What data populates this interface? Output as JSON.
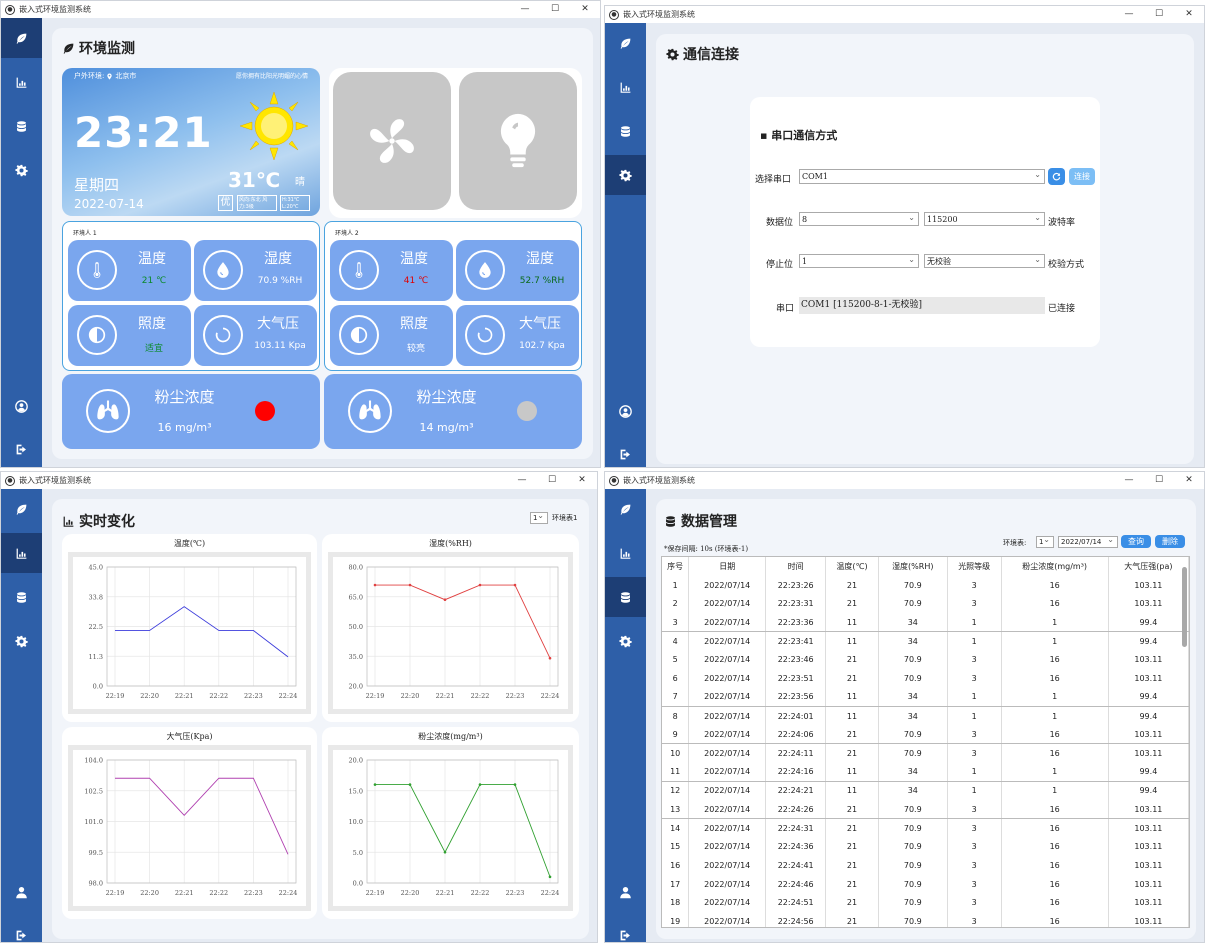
{
  "app_title": "嵌入式环境监测系统",
  "window_controls": {
    "min": "—",
    "max": "☐",
    "close": "✕"
  },
  "colors": {
    "sidebar": "#2e5fa8",
    "sidebar_active": "#1d3e75",
    "card": "#7aa6ee",
    "accent": "#3a8ee6"
  },
  "monitor": {
    "title": "环境监测",
    "weather": {
      "location_label": "户外环境:",
      "city": "北京市",
      "slogan": "愿你拥有比阳光明媚的心情",
      "time": "23:21",
      "weekday": "星期四",
      "date": "2022-07-14",
      "temp": "31℃",
      "condition": "晴",
      "aqi": "优",
      "wind": "风向:东北 风力:3级",
      "range": "H:31℃ L:20℃"
    },
    "env1": {
      "label": "环境人 1",
      "temp_title": "温度",
      "temp_value": "21 ℃",
      "hum_title": "湿度",
      "hum_value": "70.9 %RH",
      "light_title": "照度",
      "light_value": "适宜",
      "press_title": "大气压",
      "press_value": "103.11 Kpa"
    },
    "env2": {
      "label": "环境人 2",
      "temp_title": "温度",
      "temp_value": "41 ℃",
      "hum_title": "湿度",
      "hum_value": "52.7 %RH",
      "light_title": "照度",
      "light_value": "较亮",
      "press_title": "大气压",
      "press_value": "102.7 Kpa"
    },
    "dust1": {
      "title": "粉尘浓度",
      "value": "16 mg/m³",
      "status_color": "#ff0000"
    },
    "dust2": {
      "title": "粉尘浓度",
      "value": "14 mg/m³",
      "status_color": "#c8c8c8"
    }
  },
  "comm": {
    "title": "通信连接",
    "section": "串口通信方式",
    "port_label": "选择串口",
    "port_value": "COM1",
    "connect_label": "连接",
    "databits_label": "数据位",
    "databits_value": "8",
    "baud_value": "115200",
    "baud_label": "波特率",
    "stopbits_label": "停止位",
    "stopbits_value": "1",
    "parity_value": "无校验",
    "parity_label": "校验方式",
    "status_label": "串口",
    "status_value": "COM1 [115200-8-1-无校验]",
    "status_text": "已连接"
  },
  "realtime": {
    "title": "实时变化",
    "env_select": "1",
    "env_label": "环境表1"
  },
  "chart_data": [
    {
      "type": "line",
      "title": "温度(℃)",
      "x": [
        "22:19",
        "22:20",
        "22:21",
        "22:22",
        "22:23",
        "22:24"
      ],
      "series": [
        {
          "values": [
            21,
            21,
            30,
            21,
            21,
            11
          ],
          "color": "#3b3bdb"
        }
      ],
      "ylim": [
        0,
        45
      ],
      "yticks": [
        "45.0",
        "33.8",
        "22.5",
        "11.3",
        "0.0"
      ],
      "markers": false
    },
    {
      "type": "line",
      "title": "湿度(%RH)",
      "x": [
        "22:19",
        "22:20",
        "22:21",
        "22:22",
        "22:23",
        "22:24"
      ],
      "series": [
        {
          "values": [
            70.9,
            70.9,
            63.5,
            70.9,
            70.9,
            34
          ],
          "color": "#e04040"
        }
      ],
      "ylim": [
        20,
        80
      ],
      "yticks": [
        "80.0",
        "65.0",
        "50.0",
        "35.0",
        "20.0"
      ],
      "markers": true
    },
    {
      "type": "line",
      "title": "大气压(Kpa)",
      "x": [
        "22:19",
        "22:20",
        "22:21",
        "22:22",
        "22:23",
        "22:24"
      ],
      "series": [
        {
          "values": [
            103.11,
            103.11,
            101.3,
            103.11,
            103.11,
            99.4
          ],
          "color": "#b040b0"
        }
      ],
      "ylim": [
        98,
        104
      ],
      "yticks": [
        "104.0",
        "102.5",
        "101.0",
        "99.5",
        "98.0"
      ],
      "markers": false
    },
    {
      "type": "line",
      "title": "粉尘浓度(mg/m³)",
      "x": [
        "22:19",
        "22:20",
        "22:21",
        "22:22",
        "22:23",
        "22:24"
      ],
      "series": [
        {
          "values": [
            16,
            16,
            5,
            16,
            16,
            1
          ],
          "color": "#30a030"
        }
      ],
      "ylim": [
        0,
        20
      ],
      "yticks": [
        "20.0",
        "15.0",
        "10.0",
        "5.0",
        "0.0"
      ],
      "markers": true
    }
  ],
  "datamgr": {
    "title": "数据管理",
    "save_note": "*保存间隔: 10s (环境表-1)",
    "env_label": "环境表:",
    "env_value": "1",
    "date_value": "2022/07/14",
    "query_label": "查询",
    "delete_label": "删除",
    "headers": [
      "序号",
      "日期",
      "时间",
      "温度(℃)",
      "湿度(%RH)",
      "光照等级",
      "粉尘浓度(mg/m³)",
      "大气压强(pa)"
    ],
    "rows": [
      [
        "1",
        "2022/07/14",
        "22:23:26",
        "21",
        "70.9",
        "3",
        "16",
        "103.11"
      ],
      [
        "2",
        "2022/07/14",
        "22:23:31",
        "21",
        "70.9",
        "3",
        "16",
        "103.11"
      ],
      [
        "3",
        "2022/07/14",
        "22:23:36",
        "11",
        "34",
        "1",
        "1",
        "99.4"
      ],
      [
        "4",
        "2022/07/14",
        "22:23:41",
        "11",
        "34",
        "1",
        "1",
        "99.4"
      ],
      [
        "5",
        "2022/07/14",
        "22:23:46",
        "21",
        "70.9",
        "3",
        "16",
        "103.11"
      ],
      [
        "6",
        "2022/07/14",
        "22:23:51",
        "21",
        "70.9",
        "3",
        "16",
        "103.11"
      ],
      [
        "7",
        "2022/07/14",
        "22:23:56",
        "11",
        "34",
        "1",
        "1",
        "99.4"
      ],
      [
        "8",
        "2022/07/14",
        "22:24:01",
        "11",
        "34",
        "1",
        "1",
        "99.4"
      ],
      [
        "9",
        "2022/07/14",
        "22:24:06",
        "21",
        "70.9",
        "3",
        "16",
        "103.11"
      ],
      [
        "10",
        "2022/07/14",
        "22:24:11",
        "21",
        "70.9",
        "3",
        "16",
        "103.11"
      ],
      [
        "11",
        "2022/07/14",
        "22:24:16",
        "11",
        "34",
        "1",
        "1",
        "99.4"
      ],
      [
        "12",
        "2022/07/14",
        "22:24:21",
        "11",
        "34",
        "1",
        "1",
        "99.4"
      ],
      [
        "13",
        "2022/07/14",
        "22:24:26",
        "21",
        "70.9",
        "3",
        "16",
        "103.11"
      ],
      [
        "14",
        "2022/07/14",
        "22:24:31",
        "21",
        "70.9",
        "3",
        "16",
        "103.11"
      ],
      [
        "15",
        "2022/07/14",
        "22:24:36",
        "21",
        "70.9",
        "3",
        "16",
        "103.11"
      ],
      [
        "16",
        "2022/07/14",
        "22:24:41",
        "21",
        "70.9",
        "3",
        "16",
        "103.11"
      ],
      [
        "17",
        "2022/07/14",
        "22:24:46",
        "21",
        "70.9",
        "3",
        "16",
        "103.11"
      ],
      [
        "18",
        "2022/07/14",
        "22:24:51",
        "21",
        "70.9",
        "3",
        "16",
        "103.11"
      ],
      [
        "19",
        "2022/07/14",
        "22:24:56",
        "21",
        "70.9",
        "3",
        "16",
        "103.11"
      ]
    ]
  }
}
